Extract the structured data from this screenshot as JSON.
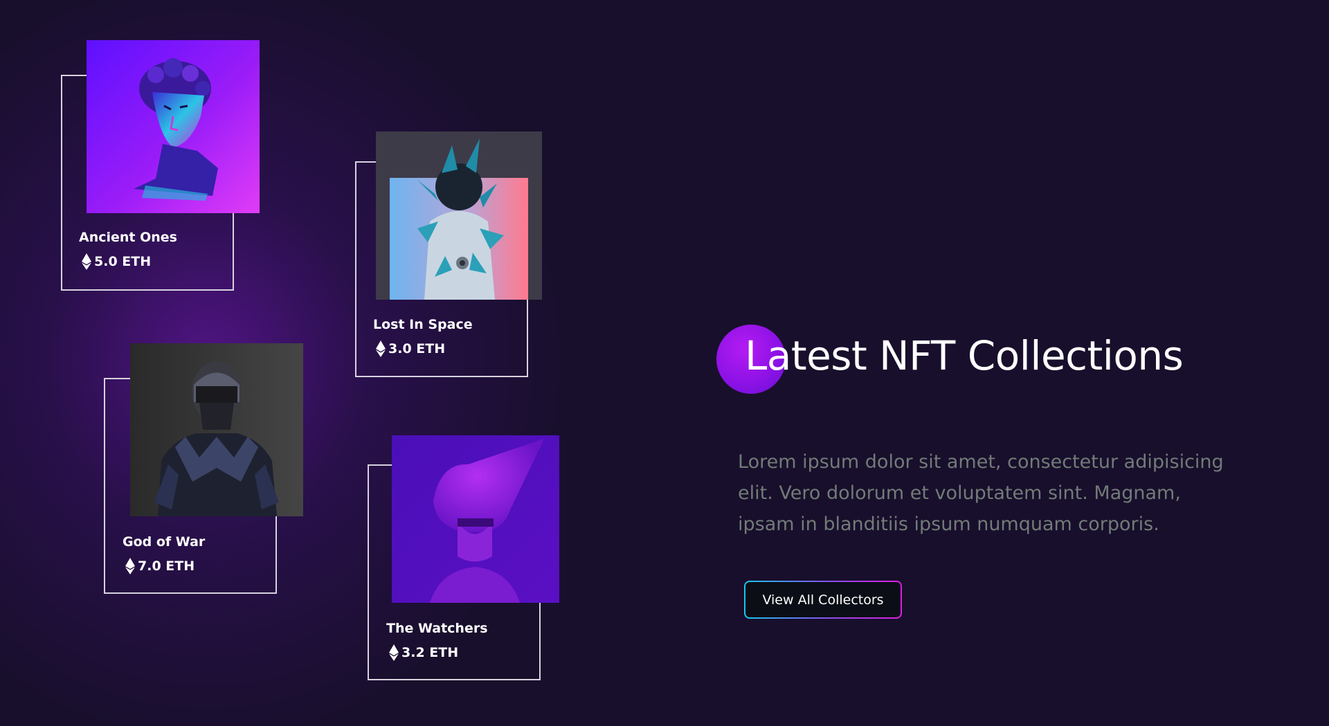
{
  "nft_cards": [
    {
      "name": "Ancient Ones",
      "price": "5.0 ETH",
      "image": "blue-purple marble bust sculpture"
    },
    {
      "name": "Lost In Space",
      "price": "3.0 ETH",
      "image": "astronaut covered in teal crystals"
    },
    {
      "name": "God of War",
      "price": "7.0 ETH",
      "image": "masked warrior in dark leather jacket"
    },
    {
      "name": "The Watchers",
      "price": "3.2 ETH",
      "image": "purple figure with conical hood"
    }
  ],
  "hero": {
    "title": "Latest NFT Collections",
    "description": "Lorem ipsum dolor sit amet, consectetur adipisicing elit. Vero dolorum et voluptatem sint. Magnam, ipsam in blanditiis ipsum numquam corporis.",
    "cta_label": "View All Collectors"
  },
  "colors": {
    "background": "#180f2c",
    "accent_purple": "#8e12e6",
    "button_gradient_start": "#16c8f0",
    "button_gradient_end": "#e21ce6",
    "description_text": "#727b78"
  },
  "icons": {
    "currency": "ethereum-icon"
  }
}
